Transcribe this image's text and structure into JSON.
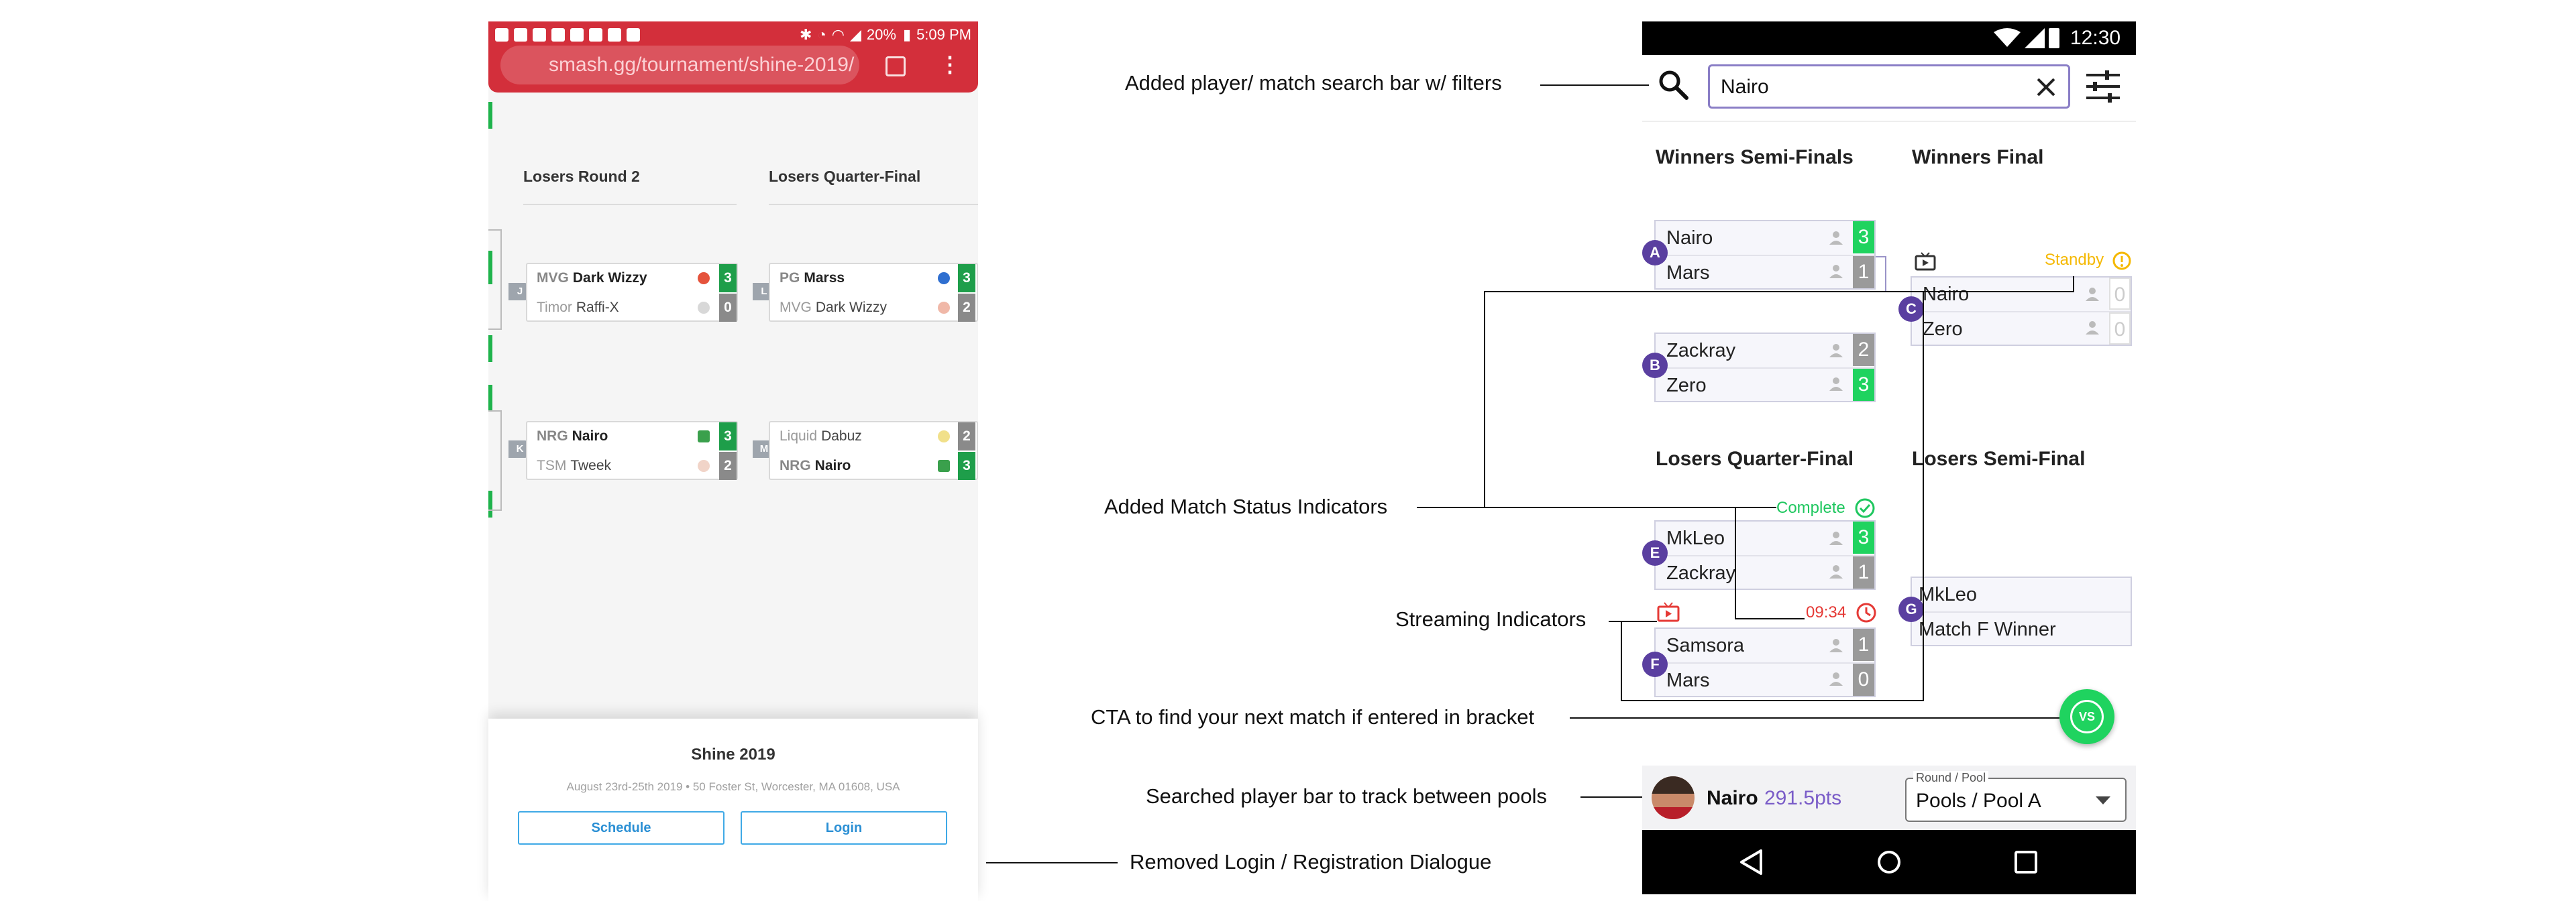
{
  "left_phone": {
    "status": {
      "percent": "20%",
      "time": "5:09 PM"
    },
    "url": "smash.gg/tournament/shine-2019/",
    "round_titles": [
      "Losers Round 2",
      "Losers Quarter-Final"
    ],
    "matches": [
      {
        "id": "J",
        "rows": [
          {
            "tag": "MVG",
            "name": "Dark Wizzy",
            "score": "3",
            "win": true
          },
          {
            "tag": "Timor",
            "name": "Raffi-X",
            "score": "0",
            "win": false
          }
        ]
      },
      {
        "id": "L",
        "rows": [
          {
            "tag": "PG",
            "name": "Marss",
            "score": "3",
            "win": true
          },
          {
            "tag": "MVG",
            "name": "Dark Wizzy",
            "score": "2",
            "win": false
          }
        ]
      },
      {
        "id": "K",
        "rows": [
          {
            "tag": "NRG",
            "name": "Nairo",
            "score": "3",
            "win": true
          },
          {
            "tag": "TSM",
            "name": "Tweek",
            "score": "2",
            "win": false
          }
        ]
      },
      {
        "id": "M",
        "rows": [
          {
            "tag": "Liquid",
            "name": "Dabuz",
            "score": "2",
            "win": false
          },
          {
            "tag": "NRG",
            "name": "Nairo",
            "score": "3",
            "win": true
          }
        ]
      }
    ],
    "footer": {
      "event": "Shine 2019",
      "details": "August 23rd-25th 2019 • 50 Foster St, Worcester, MA 01608, USA",
      "schedule": "Schedule",
      "login": "Login"
    }
  },
  "right_phone": {
    "status_time": "12:30",
    "search_value": "Nairo",
    "round_titles": [
      "Winners Semi-Finals",
      "Winners Final",
      "Losers Quarter-Final",
      "Losers Semi-Final"
    ],
    "matches": {
      "A": {
        "label": "A",
        "rows": [
          {
            "name": "Nairo",
            "score": "3"
          },
          {
            "name": "Mars",
            "score": "1"
          }
        ]
      },
      "B": {
        "label": "B",
        "rows": [
          {
            "name": "Zackray",
            "score": "2"
          },
          {
            "name": "Zero",
            "score": "3"
          }
        ]
      },
      "C": {
        "label": "C",
        "status": "Standby",
        "rows": [
          {
            "name": "Nairo",
            "score": "0"
          },
          {
            "name": "Zero",
            "score": "0"
          }
        ]
      },
      "E": {
        "label": "E",
        "status": "Complete",
        "rows": [
          {
            "name": "MkLeo",
            "score": "3"
          },
          {
            "name": "Zackray",
            "score": "1"
          }
        ]
      },
      "F": {
        "label": "F",
        "status": "09:34",
        "rows": [
          {
            "name": "Samsora",
            "score": "1"
          },
          {
            "name": "Mars",
            "score": "0"
          }
        ]
      },
      "G": {
        "label": "G",
        "rows": [
          {
            "name": "MkLeo"
          },
          {
            "name": "Match F Winner"
          }
        ]
      }
    },
    "fab_label": "VS",
    "player_bar": {
      "name": "Nairo",
      "points": "291.5pts",
      "select_label": "Round / Pool",
      "select_value": "Pools / Pool A"
    }
  },
  "annotations": {
    "search": "Added player/ match search bar w/ filters",
    "status": "Added Match Status Indicators",
    "streaming": "Streaming Indicators",
    "cta": "CTA to find your next match if entered in bracket",
    "player_bar": "Searched player bar to track between pools",
    "login": "Removed Login / Registration Dialogue"
  },
  "colors": {
    "brand_red": "#d32f3b",
    "win_green": "#1fd35f",
    "badge_purple": "#5a3fa0",
    "standby": "#f5b800",
    "complete": "#1fc75f",
    "live_red": "#e53935"
  }
}
